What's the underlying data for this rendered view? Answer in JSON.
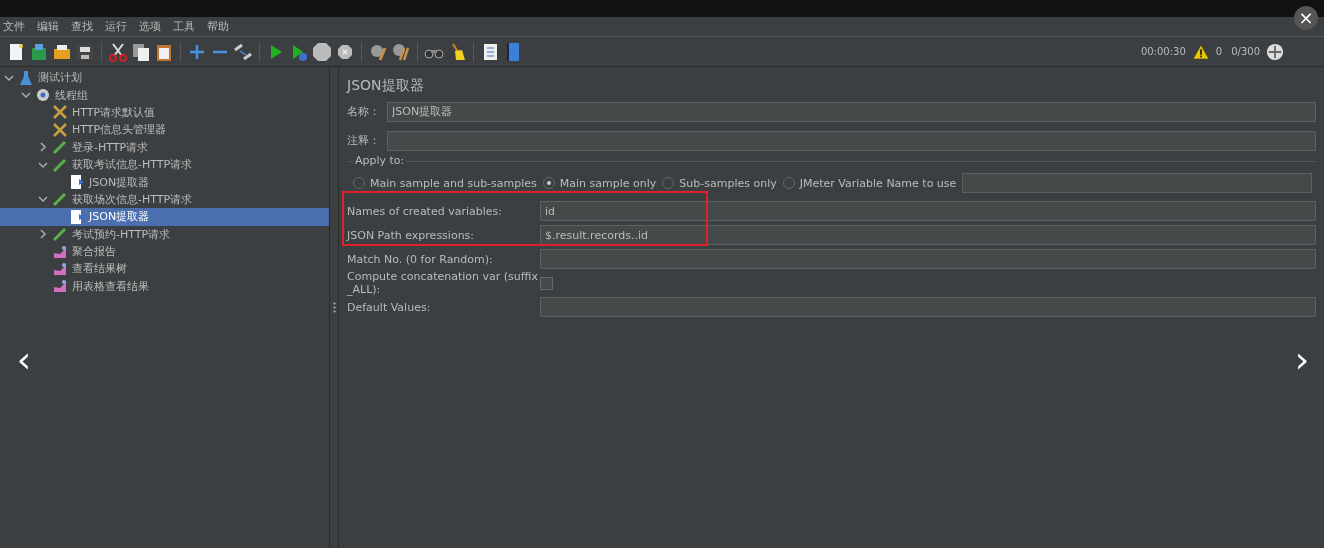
{
  "viewer": {
    "close": "×",
    "previous": "‹",
    "next": "›"
  },
  "menu": [
    "文件",
    "编辑",
    "查找",
    "运行",
    "选项",
    "工具",
    "帮助"
  ],
  "status": {
    "elapsed": "00:00:30",
    "warnings": "0",
    "threads": "0/300"
  },
  "tree": [
    {
      "label": "测试计划",
      "kind": "plan",
      "expanded": true,
      "selected": false,
      "children": [
        {
          "label": "线程组",
          "kind": "threadgroup",
          "expanded": true,
          "selected": false,
          "children": [
            {
              "label": "HTTP请求默认值",
              "kind": "config",
              "selected": false
            },
            {
              "label": "HTTP信息头管理器",
              "kind": "config",
              "selected": false
            },
            {
              "label": "登录-HTTP请求",
              "kind": "sampler",
              "expanded": false,
              "selected": false
            },
            {
              "label": "获取考试信息-HTTP请求",
              "kind": "sampler",
              "expanded": true,
              "selected": false,
              "children": [
                {
                  "label": "JSON提取器",
                  "kind": "extractor",
                  "selected": false
                }
              ]
            },
            {
              "label": "获取场次信息-HTTP请求",
              "kind": "sampler",
              "expanded": true,
              "selected": false,
              "children": [
                {
                  "label": "JSON提取器",
                  "kind": "extractor",
                  "selected": true
                }
              ]
            },
            {
              "label": "考试预约-HTTP请求",
              "kind": "sampler",
              "expanded": false,
              "selected": false
            },
            {
              "label": "聚合报告",
              "kind": "listener",
              "selected": false
            },
            {
              "label": "查看结果树",
              "kind": "listener",
              "selected": false
            },
            {
              "label": "用表格查看结果",
              "kind": "listener",
              "selected": false
            }
          ]
        }
      ]
    }
  ],
  "panel": {
    "title": "JSON提取器",
    "name_label": "名称：",
    "name_value": "JSON提取器",
    "comment_label": "注释：",
    "apply_to": "Apply to:",
    "apply_options": [
      {
        "label": "Main sample and sub-samples",
        "selected": false
      },
      {
        "label": "Main sample only",
        "selected": true
      },
      {
        "label": "Sub-samples only",
        "selected": false
      },
      {
        "label": "JMeter Variable Name to use",
        "selected": false
      }
    ],
    "rows": [
      {
        "kind": "field",
        "label": "Names of created variables:",
        "value": "id"
      },
      {
        "kind": "field",
        "label": "JSON Path expressions:",
        "value": "$.result.records..id"
      },
      {
        "kind": "field",
        "label": "Match No. (0 for Random):"
      },
      {
        "kind": "checkbox",
        "label": "Compute concatenation var (suffix _ALL):",
        "checked": false
      },
      {
        "kind": "field",
        "label": "Default Values:"
      }
    ]
  }
}
